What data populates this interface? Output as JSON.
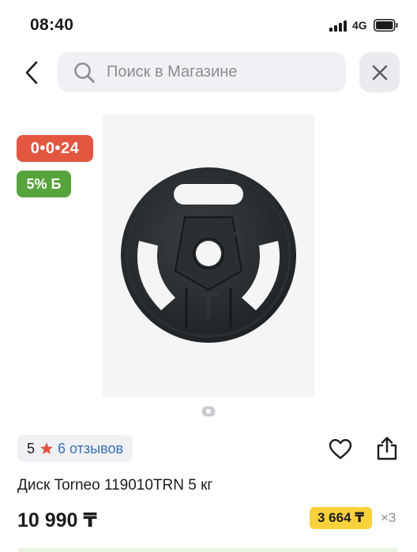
{
  "status_bar": {
    "time": "08:40",
    "network": "4G"
  },
  "search": {
    "placeholder": "Поиск в Магазине"
  },
  "icons": {
    "back": "chevron-left-icon",
    "search": "search-icon",
    "close": "close-icon",
    "star": "star-icon",
    "heart": "heart-icon",
    "share": "share-icon"
  },
  "badges": {
    "timer": "0•0•24",
    "bonus": "5% Б"
  },
  "colors": {
    "timer_badge": "#e35640",
    "bonus_badge": "#57a33c",
    "installment_badge": "#f9d23b",
    "star": "#e35640",
    "link": "#3b6fb4"
  },
  "gallery": {
    "current_page": 1,
    "total_pages": 1
  },
  "rating": {
    "value": "5",
    "reviews_label": "6 отзывов"
  },
  "product": {
    "title": "Диск Torneo 119010TRN 5 кг",
    "price": "10 990 ₸"
  },
  "installment": {
    "amount": "3 664 ₸",
    "multiplier": "×3"
  }
}
